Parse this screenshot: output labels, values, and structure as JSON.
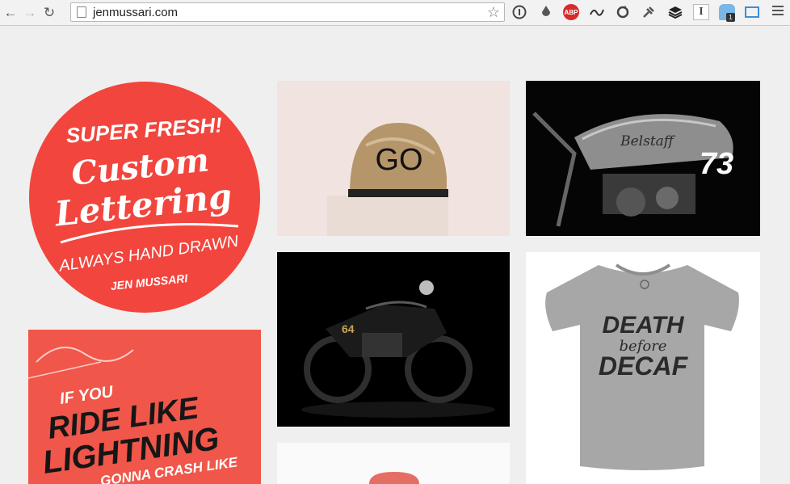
{
  "browser": {
    "url": "jenmussari.com",
    "extensions": [
      "info-icon",
      "drop-icon",
      "adblock-icon",
      "cursive-icon",
      "sync-icon",
      "pin-icon",
      "buffer-icon",
      "instapaper-icon",
      "ghostery-icon",
      "screen-icon"
    ],
    "adblock_label": "ABP",
    "instapaper_label": "I",
    "ghostery_badge": "1"
  },
  "gallery": {
    "badge": {
      "line1": "SUPER FRESH!",
      "line2": "Custom",
      "line3": "Lettering",
      "line4": "ALWAYS HAND DRAWN",
      "line5": "JEN MUSSARI"
    },
    "helmet_text": "GO",
    "moto_tank_text": "Belstaff",
    "moto_number": "73",
    "bike_number": "64",
    "poster": {
      "line1": "IF YOU",
      "line2": "RIDE LIKE",
      "line3": "LIGHTNING",
      "line4": "GONNA CRASH LIKE"
    },
    "tshirt": {
      "line1": "DEATH",
      "line2": "before",
      "line3": "DECAF"
    }
  }
}
